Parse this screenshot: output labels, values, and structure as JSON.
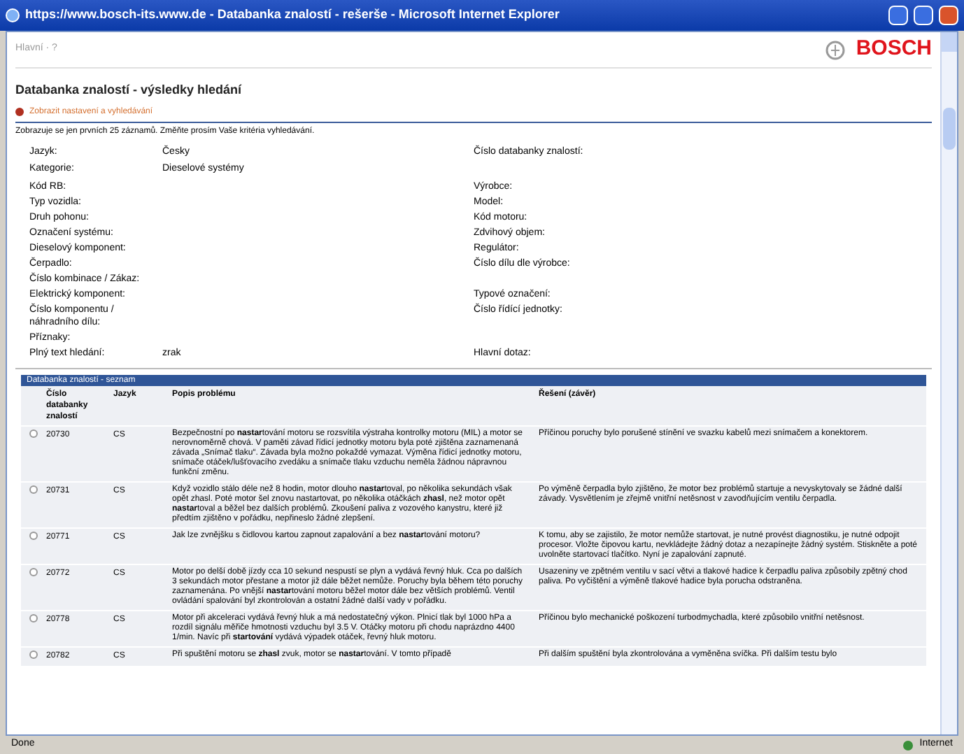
{
  "window": {
    "title": "https://www.bosch-its.www.de - Databanka znalostí - rešerše - Microsoft Internet Explorer"
  },
  "toolbar": {
    "breadcrumb": "Hlavní · ?",
    "logo": "BOSCH"
  },
  "page": {
    "heading": "Databanka znalostí - výsledky hledání",
    "link": "Zobrazit nastavení a vyhledávání",
    "notice": "Zobrazuje se jen prvních 25 záznamů. Změňte prosím Vaše kritéria vyhledávání."
  },
  "criteria": [
    {
      "left": {
        "label": "Jazyk:",
        "value": "Česky"
      },
      "right": {
        "label": "Číslo databanky znalostí:"
      }
    },
    {
      "left": {
        "label": "Kategorie:",
        "value": "Dieselové systémy"
      }
    },
    {
      "left": {
        "label": "Kód RB:"
      },
      "right": {
        "label": "Výrobce:"
      }
    },
    {
      "left": {
        "label": "Typ vozidla:"
      },
      "right": {
        "label": "Model:"
      }
    },
    {
      "left": {
        "label": "Druh pohonu:"
      },
      "right": {
        "label": "Kód motoru:"
      }
    },
    {
      "left": {
        "label": "Označení systému:"
      },
      "right": {
        "label": "Zdvihový objem:"
      }
    },
    {
      "left": {
        "label": "Dieselový komponent:"
      },
      "right": {
        "label": "Regulátor:"
      }
    },
    {
      "left": {
        "label": "Čerpadlo:"
      },
      "right": {
        "label": "Číslo dílu dle výrobce:"
      }
    },
    {
      "left": {
        "label": "Číslo kombinace / Zákaz:"
      }
    },
    {
      "left": {
        "label": "Elektrický komponent:"
      },
      "right": {
        "label": "Typové označení:"
      }
    },
    {
      "left": {
        "label": "Číslo komponentu / náhradního dílu:"
      },
      "right": {
        "label": "Číslo řídící jednotky:"
      }
    },
    {
      "left": {
        "label": "Příznaky:"
      }
    },
    {
      "left": {
        "label": "Plný text hledání:",
        "value": "zrak"
      },
      "right": {
        "label": "Hlavní dotaz:"
      }
    }
  ],
  "results": {
    "title": "Databanka znalostí - seznam",
    "columns": [
      "Číslo databanky znalostí",
      "Jazyk",
      "Popis problému",
      "Řešení (závěr)"
    ],
    "rows": [
      {
        "selected": false,
        "number": "20730",
        "language": "CS",
        "problem": "Bezpečnostní po **nastar**tování motoru se rozsvítila výstraha kontrolky motoru (MIL) a motor se nerovnoměrně chová. V paměti závad řídicí jednotky motoru byla poté zjištěna zaznamenaná závada „Snímač tlaku“. Závada byla možno pokaždé vymazat. Výměna řídicí jednotky motoru, snímače otáček/lušťovacího zvedáku a snímače tlaku vzduchu neměla žádnou nápravnou funkční změnu.",
        "solution": "Příčinou poruchy bylo porušené stínění ve svazku kabelů mezi snímačem a konektorem."
      },
      {
        "selected": false,
        "number": "20731",
        "language": "CS",
        "problem": "Když vozidlo stálo déle než 8 hodin, motor dlouho **nastar**toval, po několika sekundách však opět zhasl. Poté motor šel znovu nastartovat, po několika otáčkách **zhasl**, než motor opět **nastar**toval a běžel bez dalších problémů. Zkoušení paliva z vozového kanystru, které již předtím zjištěno v pořádku, nepřineslo žádné zlepšení.",
        "solution": "Po výměně čerpadla bylo zjištěno, že motor bez problémů startuje a nevyskytovaly se žádné další závady. Vysvětlením je zřejmě vnitřní netěsnost v zavodňujícím ventilu čerpadla."
      },
      {
        "selected": false,
        "number": "20771",
        "language": "CS",
        "problem": "Jak lze zvnějšku s čidlovou kartou zapnout zapalování a bez **nastar**tování motoru?",
        "solution": "K tomu, aby se zajistilo, že motor nemůže startovat, je nutné provést diagnostiku, je nutné odpojit procesor. Vložte čipovou kartu, nevkládejte žádný dotaz a nezapínejte žádný systém. Stiskněte a poté uvolněte startovací tlačítko. Nyní je zapalování zapnuté."
      },
      {
        "selected": false,
        "number": "20772",
        "language": "CS",
        "problem": "Motor po delší době jízdy cca 10 sekund nespustí se plyn a vydává řevný hluk. Cca po dalších 3 sekundách motor přestane a motor již dále běžet nemůže. Poruchy byla během této poruchy zaznamenána. Po vnější **nastar**tování motoru běžel motor dále bez větších problémů. Ventil ovládání spalování byl zkontrolován a ostatní žádné další vady v pořádku.",
        "solution": "Usazeniny ve zpětném ventilu v sací větvi a tlakové hadice k čerpadlu paliva způsobily zpětný chod paliva. Po vyčištění a výměně tlakové hadice byla porucha odstraněna."
      },
      {
        "selected": false,
        "number": "20778",
        "language": "CS",
        "problem": "Motor při akceleraci vydává řevný hluk a má nedostatečný výkon. Plnicí tlak byl 1000 hPa a rozdíl signálu měřiče hmotnosti vzduchu byl 3.5 V. Otáčky motoru při chodu naprázdno 4400 1/min. Navíc při **startování** vydává výpadek otáček, řevný hluk motoru.",
        "solution": "Příčinou bylo mechanické poškození turbodmychadla, které způsobilo vnitřní netěsnost."
      },
      {
        "selected": false,
        "number": "20782",
        "language": "CS",
        "problem": "Při spuštění motoru se **zhasl** zvuk, motor se **nastar**tování. V tomto případě",
        "solution": "Při dalším spuštění byla zkontrolována a vyměněna svíčka. Při dalším testu bylo"
      }
    ]
  },
  "status_bar": {
    "status": "Done",
    "zone": "Internet"
  }
}
